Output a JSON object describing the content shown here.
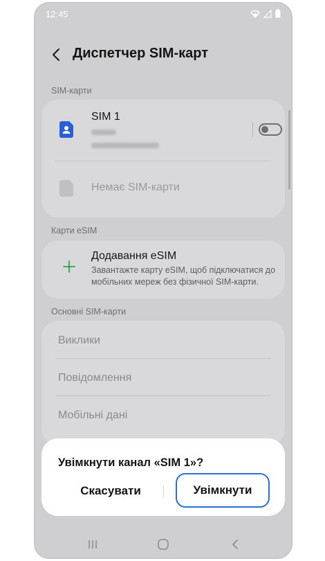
{
  "status_bar": {
    "time": "12:45"
  },
  "header": {
    "title": "Диспетчер SIM-карт"
  },
  "sim_cards": {
    "section_label": "SIM-карти",
    "sim1": {
      "name": "SIM 1",
      "toggle_on": false
    },
    "empty_slot": {
      "label": "Немає SIM-карти"
    }
  },
  "esim": {
    "section_label": "Карти eSIM",
    "add_title": "Додавання eSIM",
    "add_description": "Завантажте карту eSIM, щоб підключатися до мобільних мереж без фізичної SIM-карти."
  },
  "main_sim": {
    "section_label": "Основні SIM-карти",
    "items": [
      "Виклики",
      "Повідомлення",
      "Мобільні дані"
    ]
  },
  "dialog": {
    "title": "Увімкнути канал «SIM 1»?",
    "cancel_label": "Скасувати",
    "confirm_label": "Увімкнути"
  },
  "colors": {
    "accent_outline": "#2b6fd6",
    "sim_icon_active": "#2b5fd6",
    "plus_icon": "#2e9e4e"
  },
  "icons": {
    "back": "chevron-left-icon",
    "sim": "sim-card-icon",
    "add": "plus-icon",
    "nav": [
      "recents-icon",
      "home-icon",
      "back-icon"
    ]
  }
}
